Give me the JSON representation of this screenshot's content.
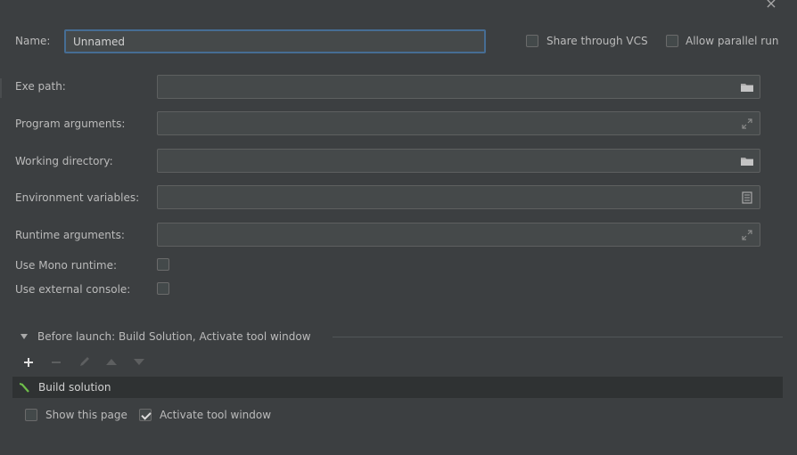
{
  "dialog": {
    "close_symbol": "×"
  },
  "header": {
    "name_label": "Name:",
    "name_value": "Unnamed",
    "share_vcs_label": "Share through VCS",
    "share_vcs_checked": false,
    "allow_parallel_label": "Allow parallel run",
    "allow_parallel_checked": false
  },
  "fields": [
    {
      "label": "Exe path:",
      "value": "",
      "icon": "folder-icon"
    },
    {
      "label": "Program arguments:",
      "value": "",
      "icon": "expand-icon"
    },
    {
      "label": "Working directory:",
      "value": "",
      "icon": "folder-icon"
    },
    {
      "label": "Environment variables:",
      "value": "",
      "icon": "list-icon"
    },
    {
      "label": "Runtime arguments:",
      "value": "",
      "icon": "expand-icon"
    }
  ],
  "options": {
    "use_mono_label": "Use Mono runtime:",
    "use_mono_checked": false,
    "use_external_console_label": "Use external console:",
    "use_external_console_checked": false
  },
  "before_launch": {
    "title": "Before launch: Build Solution, Activate tool window",
    "toolbar": [
      "add-icon",
      "remove-icon",
      "edit-icon",
      "move-up-icon",
      "move-down-icon"
    ],
    "tasks": [
      {
        "label": "Build solution",
        "icon": "hammer-icon"
      }
    ]
  },
  "footer": {
    "show_page_label": "Show this page",
    "show_page_checked": false,
    "activate_tool_label": "Activate tool window",
    "activate_tool_checked": true
  },
  "colors": {
    "background": "#3c3f41",
    "field": "#45494a",
    "focus_border": "#466d94",
    "text": "#bbbbbb"
  }
}
